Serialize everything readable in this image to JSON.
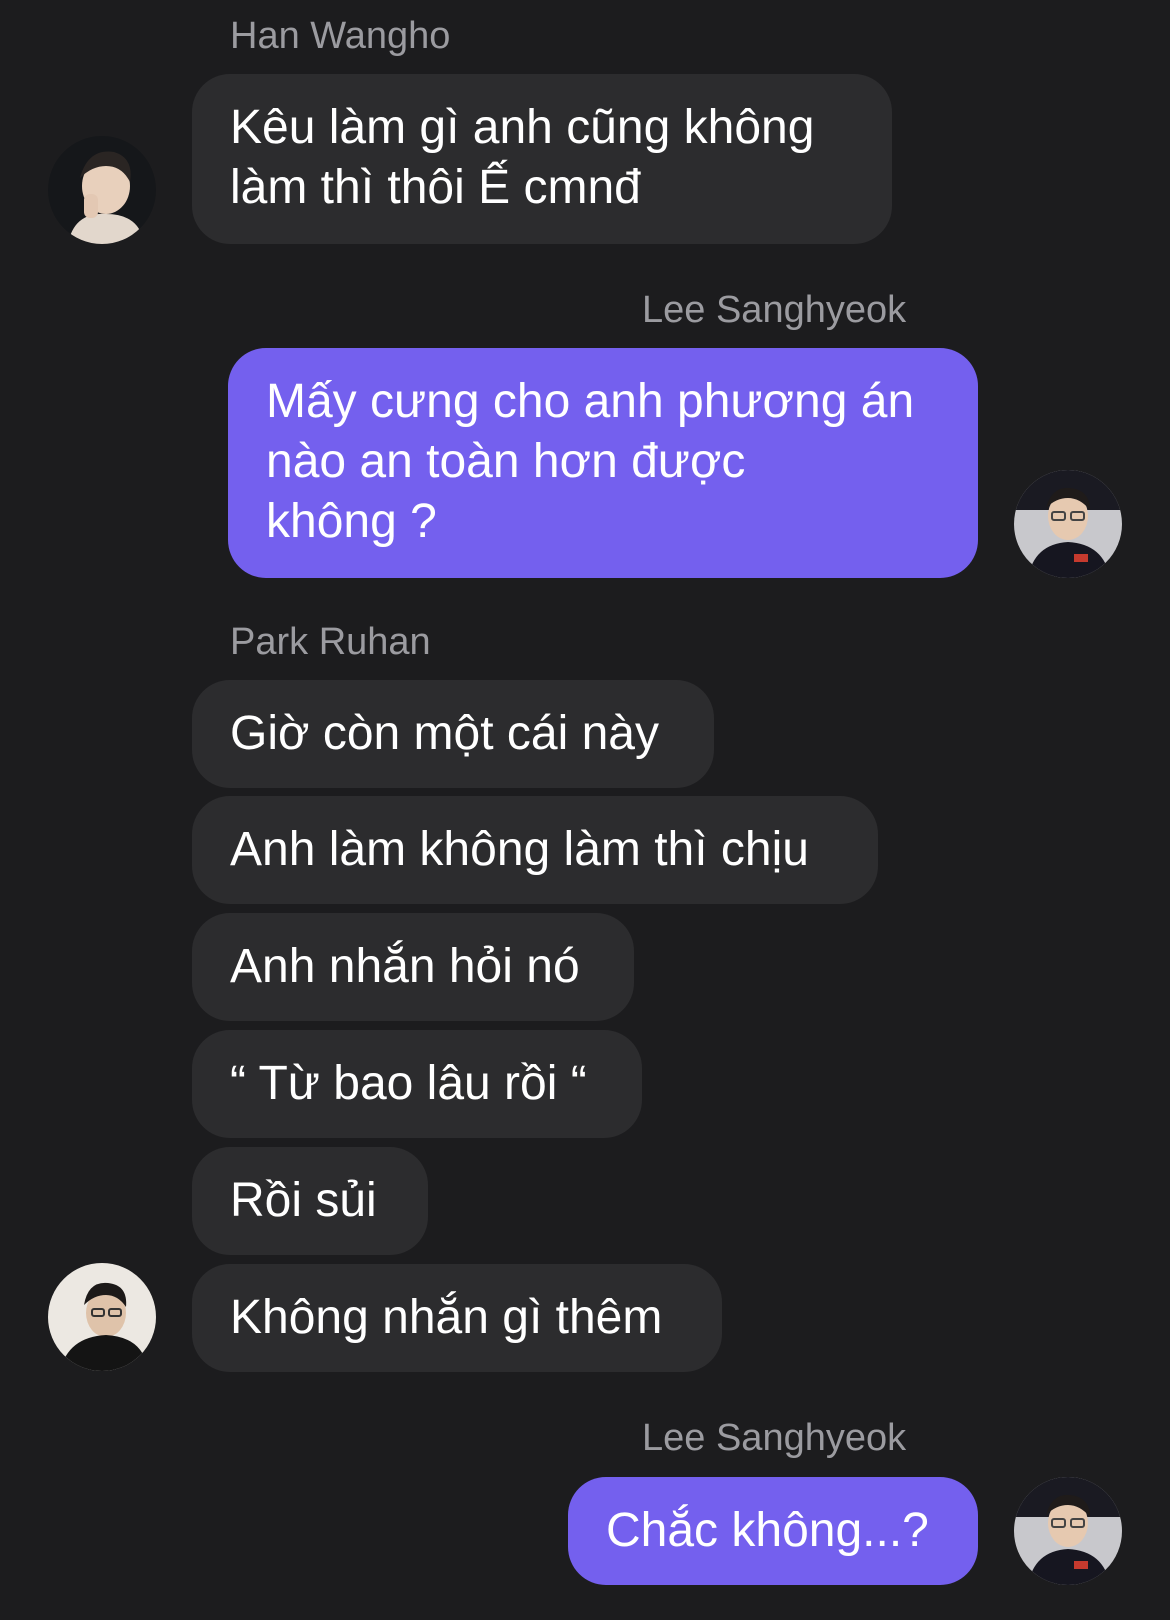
{
  "messages": [
    {
      "sender": "Han Wangho",
      "lines": [
        "Kêu làm gì anh cũng không",
        "làm thì thôi Ế cmnđ"
      ]
    },
    {
      "sender": "Lee Sanghyeok",
      "lines": [
        "Mấy cưng cho anh phương án",
        "nào an toàn hơn được",
        "không ?"
      ]
    },
    {
      "sender": "Park Ruhan",
      "bubbles": [
        "Giờ còn một cái này",
        "Anh làm không làm thì chịu",
        "Anh nhắn hỏi nó",
        "“ Từ bao lâu rồi “",
        "Rồi sủi",
        "Không nhắn gì thêm"
      ]
    },
    {
      "sender": "Lee Sanghyeok",
      "text": "Chắc không...?"
    }
  ],
  "colors": {
    "background": "#1c1c1e",
    "incoming_bubble": "#2c2c2e",
    "outgoing_bubble": "#7460ee",
    "sender_name": "#9b9ba0"
  },
  "icons": {
    "han-wangho-avatar": "avatar-photo",
    "lee-sanghyeok-avatar": "avatar-photo",
    "park-ruhan-avatar": "avatar-photo"
  }
}
